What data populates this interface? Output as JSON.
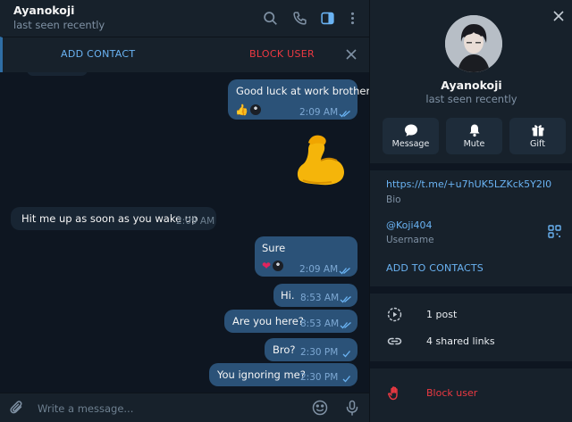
{
  "chat": {
    "title": "Ayanokoji",
    "status": "last seen recently",
    "action_bar": {
      "add_contact": "ADD CONTACT",
      "block_user": "BLOCK USER"
    },
    "composer_placeholder": "Write a message...",
    "header_icons": [
      "search-icon",
      "phone-icon",
      "sidebar-icon",
      "more-icon"
    ]
  },
  "messages": [
    {
      "text": "Good luck at work brother",
      "time": "2:09 AM",
      "direction": "out",
      "status": "read",
      "reactions": [
        "👍"
      ]
    },
    {
      "sticker": "flexed-biceps"
    },
    {
      "text": "Hit me up as soon as you wake up",
      "time": "2:09 AM",
      "direction": "in"
    },
    {
      "text": "Sure",
      "time": "2:09 AM",
      "direction": "out",
      "status": "read",
      "reactions": [
        "❤"
      ]
    },
    {
      "text": "Hi.",
      "time": "8:53 AM",
      "direction": "out",
      "status": "read"
    },
    {
      "text": "Are you here?",
      "time": "8:53 AM",
      "direction": "out",
      "status": "read"
    },
    {
      "text": "Bro?",
      "time": "2:30 PM",
      "direction": "out",
      "status": "sent"
    },
    {
      "text": "You ignoring me?",
      "time": "2:30 PM",
      "direction": "out",
      "status": "sent"
    }
  ],
  "profile": {
    "name": "Ayanokoji",
    "status": "last seen recently",
    "buttons": [
      {
        "label": "Message",
        "icon": "message-icon"
      },
      {
        "label": "Mute",
        "icon": "bell-icon"
      },
      {
        "label": "Gift",
        "icon": "gift-icon"
      }
    ],
    "link": "https://t.me/+u7hUK5LZKck5Y2I0",
    "link_label": "Bio",
    "username": "@Koji404",
    "username_label": "Username",
    "add_to_contacts": "ADD TO CONTACTS",
    "media_rows": [
      {
        "label": "1 post",
        "icon": "post-icon"
      },
      {
        "label": "4 shared links",
        "icon": "link-icon"
      }
    ],
    "block_label": "Block user"
  },
  "colors": {
    "accent": "#6ab3f3",
    "danger": "#ec3942",
    "outgoing_bubble": "#2b5278",
    "incoming_bubble": "#182533",
    "panel": "#17212b",
    "background": "#0e1621"
  }
}
